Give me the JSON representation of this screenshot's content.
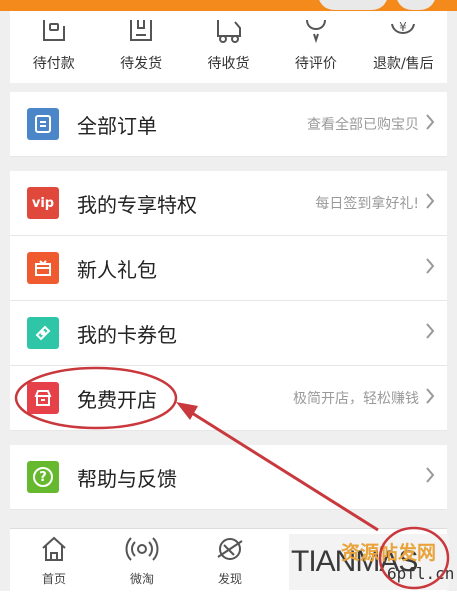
{
  "order_status": [
    {
      "label": "待付款",
      "icon": "wallet-icon"
    },
    {
      "label": "待发货",
      "icon": "package-icon"
    },
    {
      "label": "待收货",
      "icon": "truck-icon"
    },
    {
      "label": "待评价",
      "icon": "comment-icon"
    },
    {
      "label": "退款/售后",
      "icon": "refund-icon"
    }
  ],
  "menu": [
    {
      "label": "全部订单",
      "hint": "查看全部已购宝贝",
      "icon": "order-list-icon",
      "color": "#4a86c8"
    },
    {
      "label": "我的专享特权",
      "hint": "每日签到拿好礼!",
      "icon": "vip-icon",
      "icon_text": "vip",
      "color": "#e0483c"
    },
    {
      "label": "新人礼包",
      "hint": "",
      "icon": "gift-icon",
      "color": "#ef5a2f"
    },
    {
      "label": "我的卡券包",
      "hint": "",
      "icon": "ticket-icon",
      "color": "#2ec6a7"
    },
    {
      "label": "免费开店",
      "hint": "极简开店，轻松赚钱",
      "icon": "store-icon",
      "color": "#e64048"
    },
    {
      "label": "帮助与反馈",
      "hint": "",
      "icon": "help-icon",
      "icon_text": "?",
      "color": "#66b92e"
    }
  ],
  "tabs": [
    {
      "label": "首页",
      "icon": "home-icon"
    },
    {
      "label": "微淘",
      "icon": "broadcast-icon"
    },
    {
      "label": "发现",
      "icon": "planet-icon"
    }
  ],
  "watermark": {
    "latin": "TIANMAS",
    "cn": "资源帖发网",
    "url": "6pfl.cn"
  },
  "annotation_color": "#c8383c"
}
